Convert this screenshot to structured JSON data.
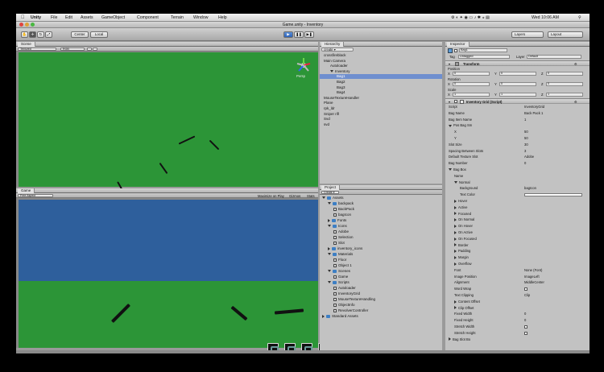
{
  "menubar": {
    "app": "Unity",
    "items": [
      "File",
      "Edit",
      "Assets",
      "GameObject",
      "Component",
      "Terrain",
      "Window",
      "Help"
    ],
    "clock": "Wed 10:06 AM"
  },
  "titlebar": {
    "title": "Game.unity - Inventory"
  },
  "toolbar": {
    "center_label": "Center",
    "local_label": "Local",
    "layers_label": "Layers",
    "layout_label": "Layout"
  },
  "scene": {
    "tab_label": "Scene",
    "mode": "Textured",
    "color_mode": "RGB",
    "gizmo_label": "Persp"
  },
  "game": {
    "tab_label": "Game",
    "aspect": "Free Aspect",
    "maximize_label": "Maximize on Play",
    "gizmos_label": "Gizmos",
    "stats_label": "Stats"
  },
  "hierarchy": {
    "tab_label": "Hierarchy",
    "search": "create ▾ ",
    "items": [
      {
        "label": "crossfireblack",
        "indent": 0,
        "sel": false
      },
      {
        "label": "Main Camera",
        "indent": 0,
        "sel": false
      },
      {
        "label": "Autoloader",
        "indent": 1,
        "sel": false
      },
      {
        "label": "Inventory",
        "indent": 1,
        "sel": false,
        "open": true
      },
      {
        "label": "Bag1",
        "indent": 2,
        "sel": true
      },
      {
        "label": "Bag2",
        "indent": 2,
        "sel": false
      },
      {
        "label": "Bag3",
        "indent": 2,
        "sel": false
      },
      {
        "label": "Bag4",
        "indent": 2,
        "sel": false
      },
      {
        "label": "MouseTextureHandler",
        "indent": 0,
        "sel": false
      },
      {
        "label": "Plane",
        "indent": 0,
        "sel": false
      },
      {
        "label": "rpk_ldr",
        "indent": 0,
        "sel": false
      },
      {
        "label": "Sniper rifl",
        "indent": 0,
        "sel": false
      },
      {
        "label": "Svd",
        "indent": 0,
        "sel": false
      },
      {
        "label": "svd",
        "indent": 0,
        "sel": false
      }
    ]
  },
  "project": {
    "tab_label": "Project",
    "create_label": "Create ▾",
    "items": [
      {
        "label": "Assets",
        "indent": 0,
        "type": "folder",
        "open": true
      },
      {
        "label": "backpack",
        "indent": 1,
        "type": "folder",
        "open": true
      },
      {
        "label": "BackPack",
        "indent": 2,
        "type": "asset"
      },
      {
        "label": "bagIcon",
        "indent": 2,
        "type": "asset"
      },
      {
        "label": "Fonts",
        "indent": 1,
        "type": "folder"
      },
      {
        "label": "Icons",
        "indent": 1,
        "type": "folder",
        "open": true
      },
      {
        "label": "Adobe",
        "indent": 2,
        "type": "asset"
      },
      {
        "label": "Selection",
        "indent": 2,
        "type": "asset"
      },
      {
        "label": "Slot",
        "indent": 2,
        "type": "asset"
      },
      {
        "label": "inventory_icons",
        "indent": 1,
        "type": "folder"
      },
      {
        "label": "Materials",
        "indent": 1,
        "type": "folder",
        "open": true
      },
      {
        "label": "Floor",
        "indent": 2,
        "type": "asset"
      },
      {
        "label": "Object 1",
        "indent": 2,
        "type": "asset"
      },
      {
        "label": "Scenes",
        "indent": 1,
        "type": "folder",
        "open": true
      },
      {
        "label": "Game",
        "indent": 2,
        "type": "asset"
      },
      {
        "label": "Scripts",
        "indent": 1,
        "type": "folder",
        "open": true
      },
      {
        "label": "Autoloader",
        "indent": 2,
        "type": "asset"
      },
      {
        "label": "InventoryGrid",
        "indent": 2,
        "type": "asset"
      },
      {
        "label": "MouseTextureHandling",
        "indent": 2,
        "type": "asset"
      },
      {
        "label": "ObjectInfo",
        "indent": 2,
        "type": "asset"
      },
      {
        "label": "RevolverController",
        "indent": 2,
        "type": "asset"
      },
      {
        "label": "Standard Assets",
        "indent": 0,
        "type": "folder"
      }
    ]
  },
  "inspector": {
    "tab_label": "Inspector",
    "object_name": "Bag1",
    "tag_label": "Tag",
    "tag_value": "Untagged",
    "layer_label": "Layer",
    "layer_value": "Default",
    "transform_title": "Transform",
    "position_label": "Position",
    "position": {
      "x": "0",
      "y": "0",
      "z": "0"
    },
    "rotation_label": "Rotation",
    "rotation": {
      "x": "0",
      "y": "0",
      "z": "0"
    },
    "scale_label": "Scale",
    "scale": {
      "x": "1",
      "y": "1",
      "z": "1"
    },
    "script_title": "Inventory Grid (Script)",
    "fields": [
      {
        "label": "Script",
        "value": "InventoryGrid",
        "indent": 0
      },
      {
        "label": "Bag Name",
        "value": "Back Pack 1",
        "indent": 0
      },
      {
        "label": "Bag Item Name",
        "value": "1",
        "indent": 0
      },
      {
        "label": "Pos Bag Sm",
        "value": "",
        "indent": 0,
        "fold": true
      },
      {
        "label": "X",
        "value": "50",
        "indent": 1
      },
      {
        "label": "Y",
        "value": "50",
        "indent": 1
      },
      {
        "label": "Slot Size",
        "value": "30",
        "indent": 0
      },
      {
        "label": "Spacing Between Slots",
        "value": "3",
        "indent": 0
      },
      {
        "label": "Default Texture Slot",
        "value": "Adobe",
        "indent": 0
      },
      {
        "label": "Bag Number",
        "value": "0",
        "indent": 0
      },
      {
        "label": "Bag Box",
        "value": "",
        "indent": 0,
        "fold": true
      },
      {
        "label": "Name",
        "value": "",
        "indent": 1
      },
      {
        "label": "Normal",
        "value": "",
        "indent": 1,
        "fold": true
      },
      {
        "label": "Background",
        "value": "bagIcon",
        "indent": 2
      },
      {
        "label": "Text Color",
        "value": "",
        "indent": 2,
        "color": true
      },
      {
        "label": "Hover",
        "value": "",
        "indent": 1,
        "foldr": true
      },
      {
        "label": "Active",
        "value": "",
        "indent": 1,
        "foldr": true
      },
      {
        "label": "Focused",
        "value": "",
        "indent": 1,
        "foldr": true
      },
      {
        "label": "On Normal",
        "value": "",
        "indent": 1,
        "foldr": true
      },
      {
        "label": "On Hover",
        "value": "",
        "indent": 1,
        "foldr": true
      },
      {
        "label": "On Active",
        "value": "",
        "indent": 1,
        "foldr": true
      },
      {
        "label": "On Focused",
        "value": "",
        "indent": 1,
        "foldr": true
      },
      {
        "label": "Border",
        "value": "",
        "indent": 1,
        "foldr": true
      },
      {
        "label": "Padding",
        "value": "",
        "indent": 1,
        "foldr": true
      },
      {
        "label": "Margin",
        "value": "",
        "indent": 1,
        "foldr": true
      },
      {
        "label": "Overflow",
        "value": "",
        "indent": 1,
        "foldr": true
      },
      {
        "label": "Font",
        "value": "None (Font)",
        "indent": 1
      },
      {
        "label": "Image Position",
        "value": "ImageLeft",
        "indent": 1
      },
      {
        "label": "Alignment",
        "value": "MiddleCenter",
        "indent": 1
      },
      {
        "label": "Word Wrap",
        "value": "",
        "indent": 1,
        "check": true
      },
      {
        "label": "Text Clipping",
        "value": "Clip",
        "indent": 1
      },
      {
        "label": "Content Offset",
        "value": "",
        "indent": 1,
        "foldr": true
      },
      {
        "label": "Clip Offset",
        "value": "",
        "indent": 1,
        "foldr": true
      },
      {
        "label": "Fixed Width",
        "value": "0",
        "indent": 1
      },
      {
        "label": "Fixed Height",
        "value": "0",
        "indent": 1
      },
      {
        "label": "Stretch Width",
        "value": "",
        "indent": 1,
        "check": true
      },
      {
        "label": "Stretch Height",
        "value": "",
        "indent": 1,
        "check": true
      },
      {
        "label": "Bag Slot Bo",
        "value": "",
        "indent": 0,
        "foldr": true
      }
    ]
  },
  "colors": {
    "scene_green": "#2c9537",
    "sky_blue": "#2e5f9c",
    "selection": "#6f8fcf"
  }
}
